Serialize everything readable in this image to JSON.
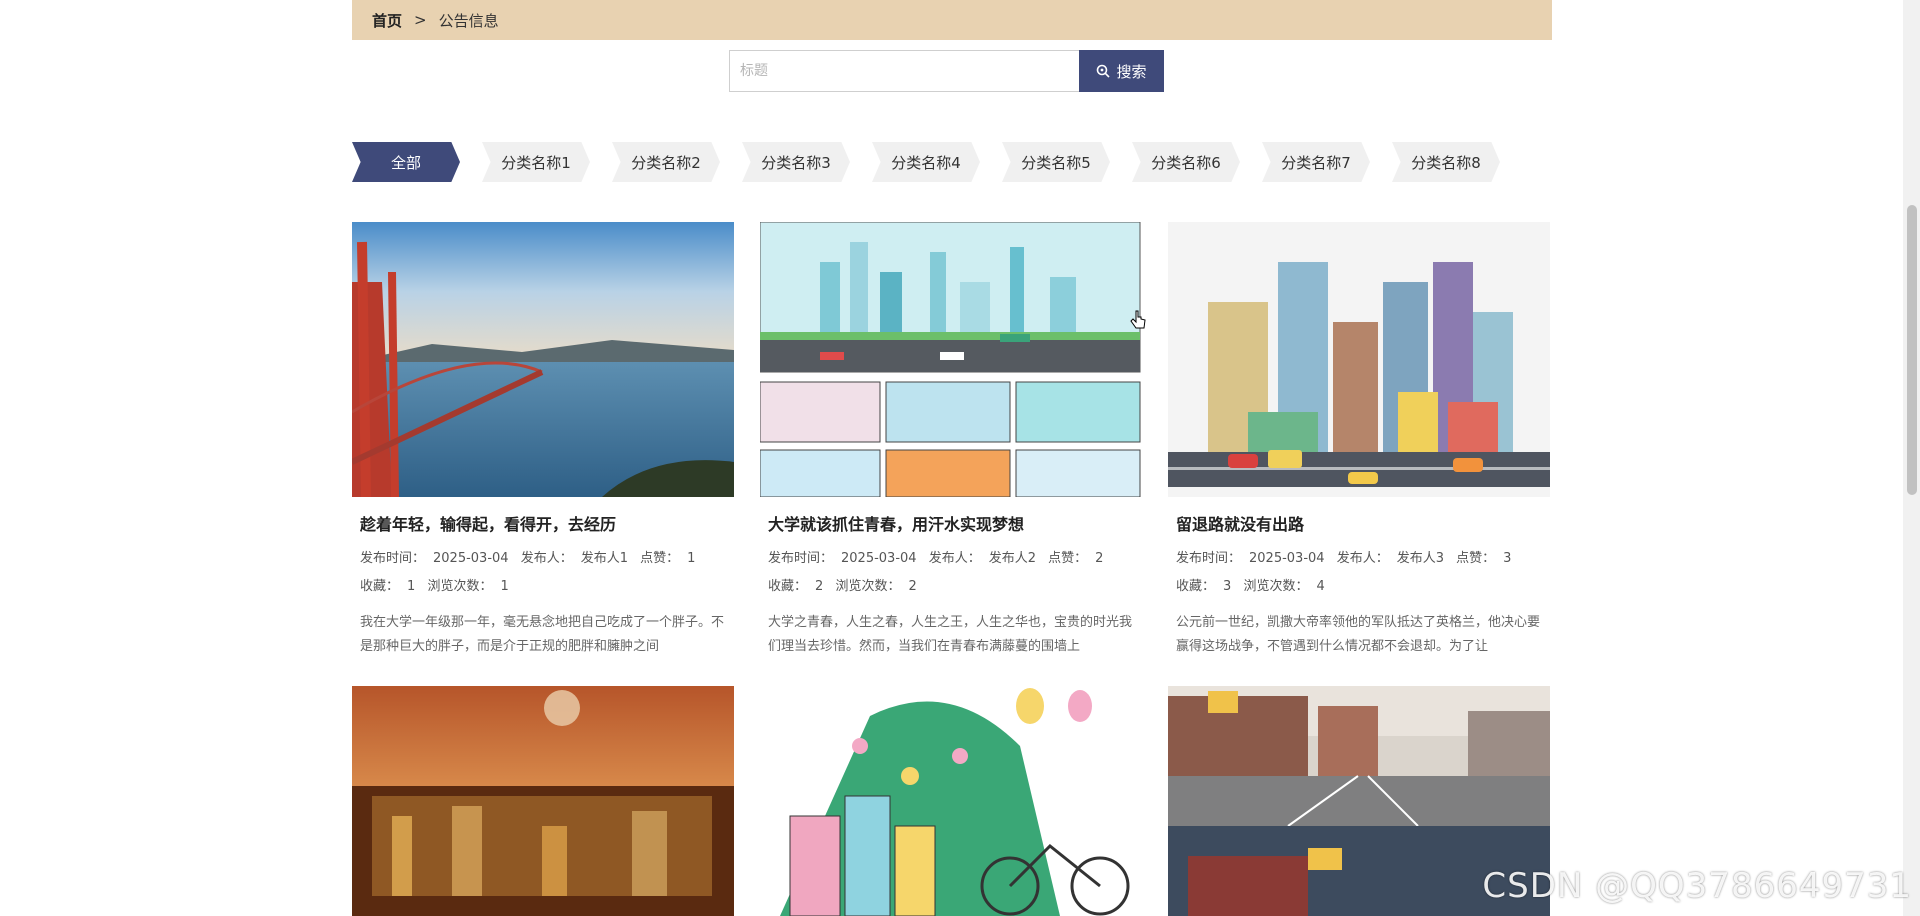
{
  "breadcrumb": {
    "home": "首页",
    "sep": ">",
    "current": "公告信息"
  },
  "search": {
    "placeholder": "标题",
    "value": "",
    "button_label": "搜索"
  },
  "categories": [
    "全部",
    "分类名称1",
    "分类名称2",
    "分类名称3",
    "分类名称4",
    "分类名称5",
    "分类名称6",
    "分类名称7",
    "分类名称8"
  ],
  "active_category": "全部",
  "cards": [
    {
      "title": "趁着年轻，输得起，看得开，去经历",
      "time_label": "发布时间：",
      "time": "2025-03-04",
      "publisher_label": "发布人：",
      "publisher": "发布人1",
      "likes_label": "点赞：",
      "likes": "1",
      "fav_label": "收藏：",
      "fav": "1",
      "views_label": "浏览次数：",
      "views": "1",
      "desc": "我在大学一年级那一年，毫无悬念地把自己吃成了一个胖子。不是那种巨大的胖子，而是介于正规的肥胖和臃肿之间",
      "image": "golden-gate-bridge-photo"
    },
    {
      "title": "大学就该抓住青春，用汗水实现梦想",
      "time_label": "发布时间：",
      "time": "2025-03-04",
      "publisher_label": "发布人：",
      "publisher": "发布人2",
      "likes_label": "点赞：",
      "likes": "2",
      "fav_label": "收藏：",
      "fav": "2",
      "views_label": "浏览次数：",
      "views": "2",
      "desc": "大学之青春，人生之春，人生之王，人生之华也，宝贵的时光我们理当去珍惜。然而，当我们在青春布满藤蔓的围墙上",
      "image": "cartoon-city-collage"
    },
    {
      "title": "留退路就没有出路",
      "time_label": "发布时间：",
      "time": "2025-03-04",
      "publisher_label": "发布人：",
      "publisher": "发布人3",
      "likes_label": "点赞：",
      "likes": "3",
      "fav_label": "收藏：",
      "fav": "3",
      "views_label": "浏览次数：",
      "views": "4",
      "desc": "公元前一世纪，凯撒大帝率领他的军队抵达了英格兰，他决心要赢得这场战争，不管遇到什么情况都不会退却。为了让",
      "image": "flat-city-illustration"
    },
    {
      "image": "night-city-moon-photo"
    },
    {
      "image": "green-hill-bicycle-illustration"
    },
    {
      "image": "3d-street-render"
    }
  ],
  "watermark": "CSDN @QQ3786649731"
}
